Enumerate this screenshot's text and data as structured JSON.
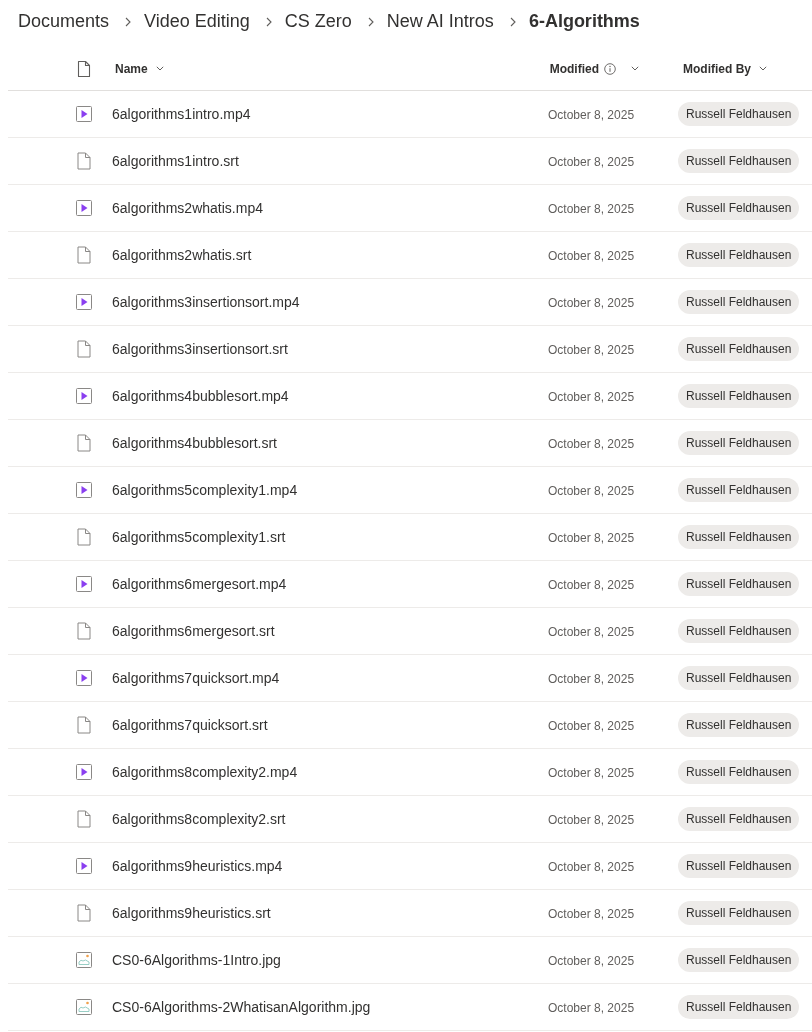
{
  "breadcrumb": [
    {
      "label": "Documents",
      "current": false
    },
    {
      "label": "Video Editing",
      "current": false
    },
    {
      "label": "CS Zero",
      "current": false
    },
    {
      "label": "New AI Intros",
      "current": false
    },
    {
      "label": "6-Algorithms",
      "current": true
    }
  ],
  "columns": [
    {
      "label": "Name",
      "info": false
    },
    {
      "label": "Modified",
      "info": true
    },
    {
      "label": "Modified By",
      "info": false
    }
  ],
  "rows": [
    {
      "kind": "video",
      "name": "6algorithms1intro.mp4",
      "modified": "October 8, 2025",
      "modified_by": "Russell Feldhausen"
    },
    {
      "kind": "file",
      "name": "6algorithms1intro.srt",
      "modified": "October 8, 2025",
      "modified_by": "Russell Feldhausen"
    },
    {
      "kind": "video",
      "name": "6algorithms2whatis.mp4",
      "modified": "October 8, 2025",
      "modified_by": "Russell Feldhausen"
    },
    {
      "kind": "file",
      "name": "6algorithms2whatis.srt",
      "modified": "October 8, 2025",
      "modified_by": "Russell Feldhausen"
    },
    {
      "kind": "video",
      "name": "6algorithms3insertionsort.mp4",
      "modified": "October 8, 2025",
      "modified_by": "Russell Feldhausen"
    },
    {
      "kind": "file",
      "name": "6algorithms3insertionsort.srt",
      "modified": "October 8, 2025",
      "modified_by": "Russell Feldhausen"
    },
    {
      "kind": "video",
      "name": "6algorithms4bubblesort.mp4",
      "modified": "October 8, 2025",
      "modified_by": "Russell Feldhausen"
    },
    {
      "kind": "file",
      "name": "6algorithms4bubblesort.srt",
      "modified": "October 8, 2025",
      "modified_by": "Russell Feldhausen"
    },
    {
      "kind": "video",
      "name": "6algorithms5complexity1.mp4",
      "modified": "October 8, 2025",
      "modified_by": "Russell Feldhausen"
    },
    {
      "kind": "file",
      "name": "6algorithms5complexity1.srt",
      "modified": "October 8, 2025",
      "modified_by": "Russell Feldhausen"
    },
    {
      "kind": "video",
      "name": "6algorithms6mergesort.mp4",
      "modified": "October 8, 2025",
      "modified_by": "Russell Feldhausen"
    },
    {
      "kind": "file",
      "name": "6algorithms6mergesort.srt",
      "modified": "October 8, 2025",
      "modified_by": "Russell Feldhausen"
    },
    {
      "kind": "video",
      "name": "6algorithms7quicksort.mp4",
      "modified": "October 8, 2025",
      "modified_by": "Russell Feldhausen"
    },
    {
      "kind": "file",
      "name": "6algorithms7quicksort.srt",
      "modified": "October 8, 2025",
      "modified_by": "Russell Feldhausen"
    },
    {
      "kind": "video",
      "name": "6algorithms8complexity2.mp4",
      "modified": "October 8, 2025",
      "modified_by": "Russell Feldhausen"
    },
    {
      "kind": "file",
      "name": "6algorithms8complexity2.srt",
      "modified": "October 8, 2025",
      "modified_by": "Russell Feldhausen"
    },
    {
      "kind": "video",
      "name": "6algorithms9heuristics.mp4",
      "modified": "October 8, 2025",
      "modified_by": "Russell Feldhausen"
    },
    {
      "kind": "file",
      "name": "6algorithms9heuristics.srt",
      "modified": "October 8, 2025",
      "modified_by": "Russell Feldhausen"
    },
    {
      "kind": "image",
      "name": "CS0-6Algorithms-1Intro.jpg",
      "modified": "October 8, 2025",
      "modified_by": "Russell Feldhausen"
    },
    {
      "kind": "image",
      "name": "CS0-6Algorithms-2WhatisanAlgorithm.jpg",
      "modified": "October 8, 2025",
      "modified_by": "Russell Feldhausen"
    }
  ]
}
